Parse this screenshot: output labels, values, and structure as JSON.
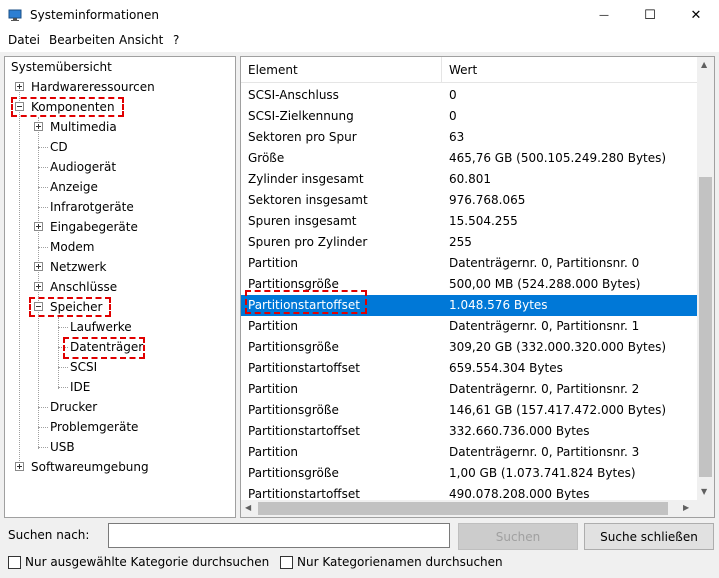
{
  "window": {
    "title": "Systeminformationen",
    "minimize_glyph": "—",
    "maximize_glyph": "☐",
    "close_glyph": "✕"
  },
  "menu": [
    "Datei",
    "Bearbeiten",
    "Ansicht",
    "?"
  ],
  "tree": {
    "root": "Systemübersicht",
    "hardware": "Hardwareressourcen",
    "components": "Komponenten",
    "multimedia": "Multimedia",
    "cd": "CD",
    "audio": "Audiogerät",
    "display": "Anzeige",
    "infrared": "Infrarotgeräte",
    "input": "Eingabegeräte",
    "modem": "Modem",
    "network": "Netzwerk",
    "ports": "Anschlüsse",
    "storage": "Speicher",
    "drives": "Laufwerke",
    "disks": "Datenträger",
    "scsi": "SCSI",
    "ide": "IDE",
    "printer": "Drucker",
    "problem": "Problemgeräte",
    "usb": "USB",
    "software": "Softwareumgebung"
  },
  "list": {
    "headers": {
      "element": "Element",
      "value": "Wert"
    },
    "rows": [
      {
        "element": "SCSI-Anschluss",
        "value": "0"
      },
      {
        "element": "SCSI-Zielkennung",
        "value": "0"
      },
      {
        "element": "Sektoren pro Spur",
        "value": "63"
      },
      {
        "element": "Größe",
        "value": "465,76 GB (500.105.249.280 Bytes)"
      },
      {
        "element": "Zylinder insgesamt",
        "value": "60.801"
      },
      {
        "element": "Sektoren insgesamt",
        "value": "976.768.065"
      },
      {
        "element": "Spuren insgesamt",
        "value": "15.504.255"
      },
      {
        "element": "Spuren pro Zylinder",
        "value": "255"
      },
      {
        "element": "Partition",
        "value": "Datenträgernr. 0, Partitionsnr. 0"
      },
      {
        "element": "Partitionsgröße",
        "value": "500,00 MB (524.288.000 Bytes)"
      },
      {
        "element": "Partitionstartoffset",
        "value": "1.048.576 Bytes"
      },
      {
        "element": "Partition",
        "value": "Datenträgernr. 0, Partitionsnr. 1"
      },
      {
        "element": "Partitionsgröße",
        "value": "309,20 GB (332.000.320.000 Bytes)"
      },
      {
        "element": "Partitionstartoffset",
        "value": "659.554.304 Bytes"
      },
      {
        "element": "Partition",
        "value": "Datenträgernr. 0, Partitionsnr. 2"
      },
      {
        "element": "Partitionsgröße",
        "value": "146,61 GB (157.417.472.000 Bytes)"
      },
      {
        "element": "Partitionstartoffset",
        "value": "332.660.736.000 Bytes"
      },
      {
        "element": "Partition",
        "value": "Datenträgernr. 0, Partitionsnr. 3"
      },
      {
        "element": "Partitionsgröße",
        "value": "1,00 GB (1.073.741.824 Bytes)"
      },
      {
        "element": "Partitionstartoffset",
        "value": "490.078.208.000 Bytes"
      }
    ],
    "selected_index": 10
  },
  "search": {
    "label": "Suchen nach:",
    "input_value": "",
    "search_button": "Suchen",
    "close_button": "Suche schließen"
  },
  "options": {
    "selected_only": "Nur ausgewählte Kategorie durchsuchen",
    "names_only": "Nur Kategorienamen durchsuchen"
  },
  "colors": {
    "selection": "#0078d7",
    "highlight": "#e00000"
  }
}
